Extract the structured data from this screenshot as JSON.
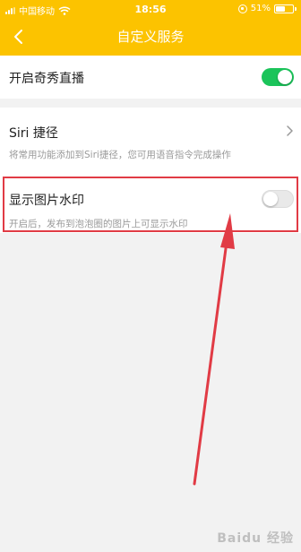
{
  "status_bar": {
    "carrier": "中国移动",
    "time": "18:56",
    "battery": "51%"
  },
  "nav": {
    "title": "自定义服务"
  },
  "settings": {
    "live": {
      "label": "开启奇秀直播",
      "enabled": true
    },
    "siri": {
      "label": "Siri 捷径",
      "description": "将常用功能添加到Siri捷径，您可用语音指令完成操作"
    },
    "watermark": {
      "label": "显示图片水印",
      "description": "开启后，发布到泡泡圈的图片上可显示水印",
      "enabled": false
    }
  },
  "watermark_logo": "Baidu 经验",
  "colors": {
    "header": "#fcc300",
    "toggle_on": "#1bc45a",
    "toggle_off": "#e9e9e9",
    "annotation": "#e13b45"
  }
}
